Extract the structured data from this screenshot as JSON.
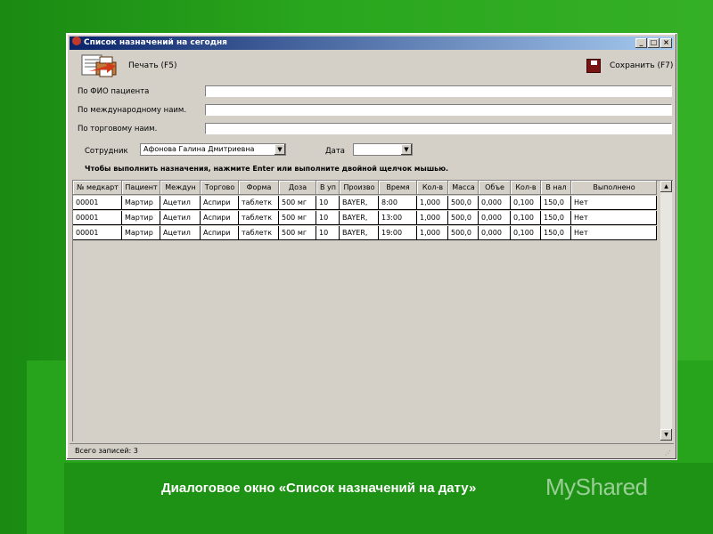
{
  "window": {
    "title": "Список назначений на сегодня",
    "controls": [
      "_",
      "□",
      "×"
    ]
  },
  "toolbar": {
    "print_label": "Печать (F5)",
    "save_label": "Сохранить (F7)"
  },
  "filters": {
    "patient_label": "По ФИО пациента",
    "intl_label": "По международному наим.",
    "trade_label": "По торговому наим.",
    "patient_value": "",
    "intl_value": "",
    "trade_value": ""
  },
  "employee": {
    "label": "Сотрудник",
    "value": "Афонова Галина Дмитриевна"
  },
  "date": {
    "label": "Дата",
    "value": ""
  },
  "hint": "Чтобы выполнить назначения, нажмите Enter или выполните двойной щелчок мышью.",
  "grid": {
    "columns": [
      "№ медкарт",
      "Пациент",
      "Междун",
      "Торгово",
      "Форма",
      "Доза",
      "В уп",
      "Произво",
      "Время",
      "Кол-в",
      "Масса",
      "Объе",
      "Кол-в",
      "В нал",
      "Выполнено"
    ],
    "rows": [
      [
        "00001",
        "Мартир",
        "Ацетил",
        "Аспири",
        "таблетк",
        "500 мг",
        "10",
        "BAYER,",
        "8:00",
        "1,000",
        "500,0",
        "0,000",
        "0,100",
        "150,0",
        "Нет"
      ],
      [
        "00001",
        "Мартир",
        "Ацетил",
        "Аспири",
        "таблетк",
        "500 мг",
        "10",
        "BAYER,",
        "13:00",
        "1,000",
        "500,0",
        "0,000",
        "0,100",
        "150,0",
        "Нет"
      ],
      [
        "00001",
        "Мартир",
        "Ацетил",
        "Аспири",
        "таблетк",
        "500 мг",
        "10",
        "BAYER,",
        "19:00",
        "1,000",
        "500,0",
        "0,000",
        "0,100",
        "150,0",
        "Нет"
      ]
    ]
  },
  "status": "Всего записей: 3",
  "caption": "Диалоговое окно «Список назначений на дату»",
  "watermark": "MyShared",
  "colors": {
    "background": "#1f9a16",
    "window": "#d4d0c8",
    "title_start": "#0a246a",
    "title_end": "#a6caf0"
  }
}
